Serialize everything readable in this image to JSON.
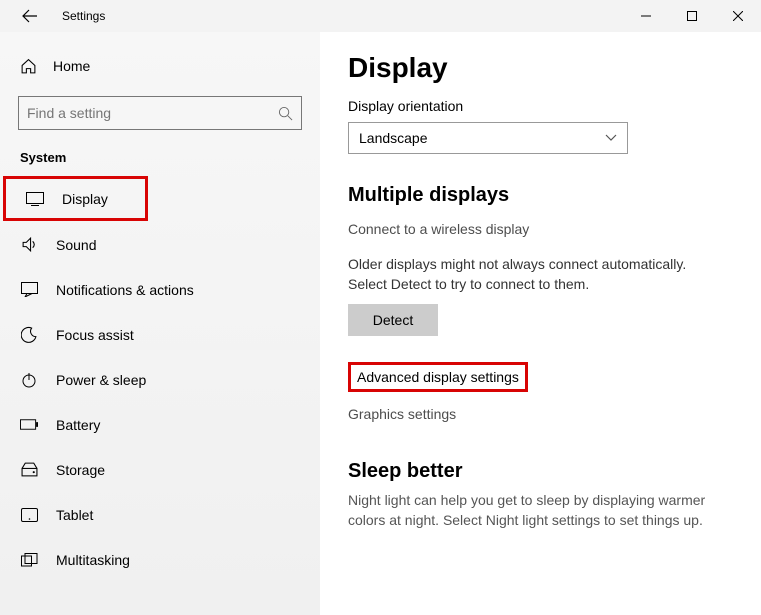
{
  "titlebar": {
    "title": "Settings"
  },
  "sidebar": {
    "home": "Home",
    "search_placeholder": "Find a setting",
    "section": "System",
    "items": [
      {
        "label": "Display"
      },
      {
        "label": "Sound"
      },
      {
        "label": "Notifications & actions"
      },
      {
        "label": "Focus assist"
      },
      {
        "label": "Power & sleep"
      },
      {
        "label": "Battery"
      },
      {
        "label": "Storage"
      },
      {
        "label": "Tablet"
      },
      {
        "label": "Multitasking"
      }
    ]
  },
  "content": {
    "page_title": "Display",
    "orientation_label": "Display orientation",
    "orientation_value": "Landscape",
    "multi_head": "Multiple displays",
    "connect_link": "Connect to a wireless display",
    "detect_text": "Older displays might not always connect automatically. Select Detect to try to connect to them.",
    "detect_btn": "Detect",
    "advanced_link": "Advanced display settings",
    "graphics_link": "Graphics settings",
    "sleep_head": "Sleep better",
    "sleep_text": "Night light can help you get to sleep by displaying warmer colors at night. Select Night light settings to set things up."
  }
}
